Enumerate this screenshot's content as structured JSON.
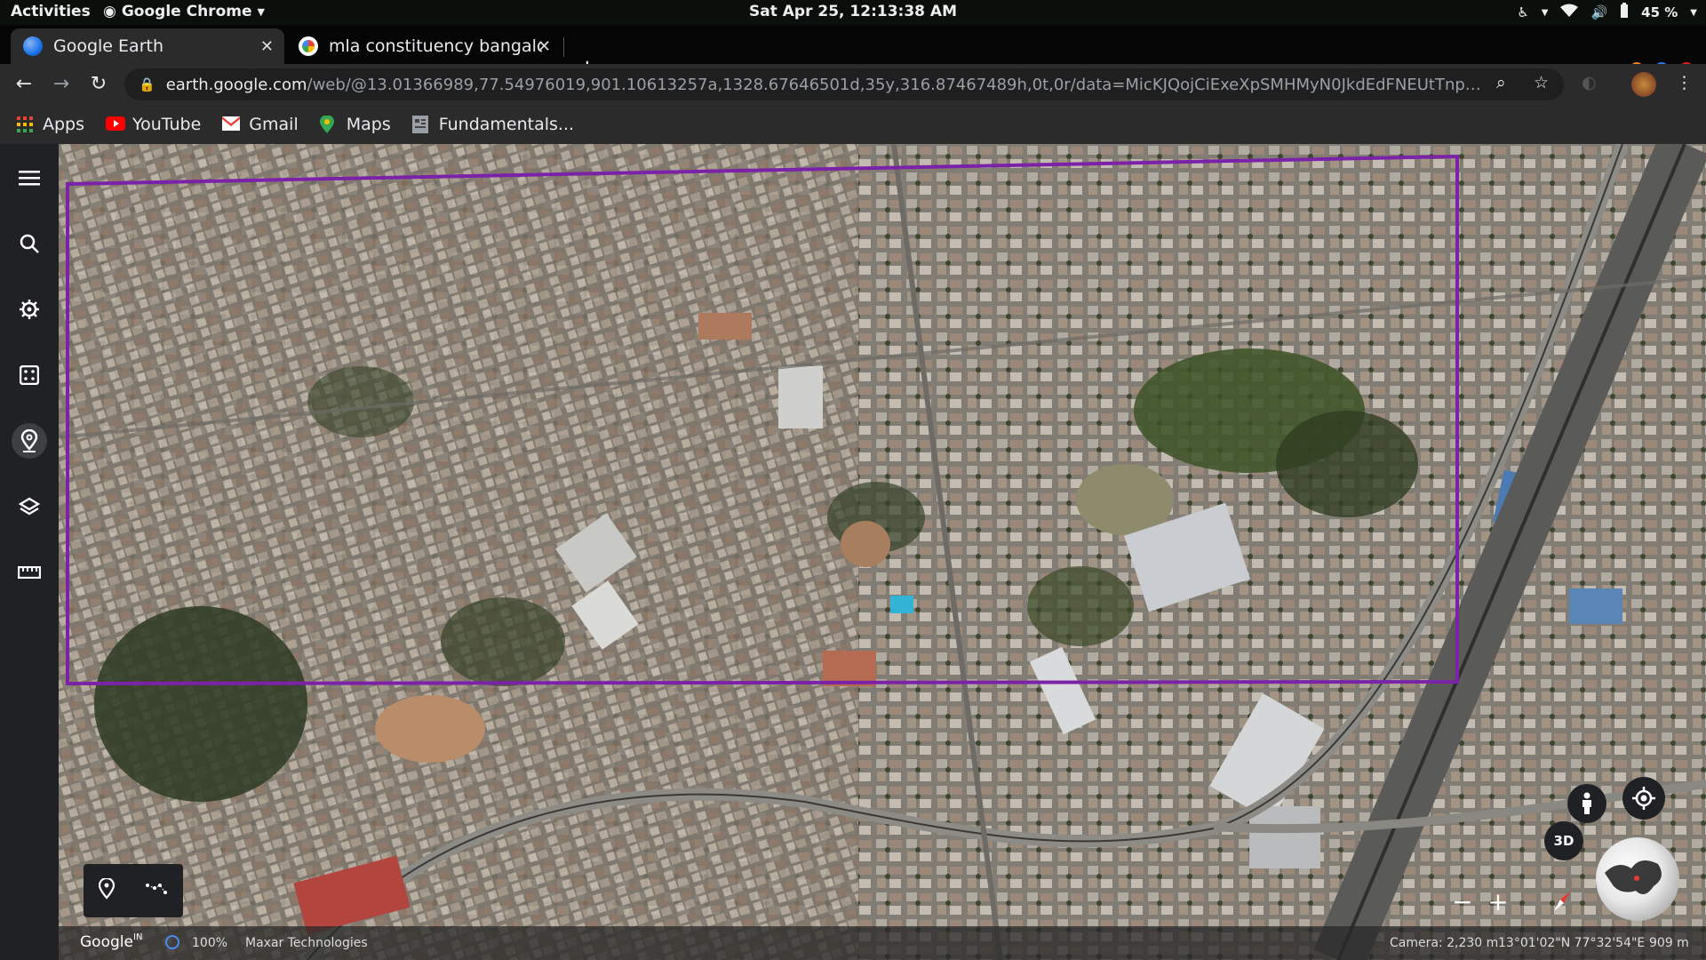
{
  "topbar": {
    "activities": "Activities",
    "app_name": "Google Chrome",
    "clock": "Sat Apr 25, 12:13:38 AM",
    "battery": "45 %"
  },
  "tabs": [
    {
      "title": "Google Earth",
      "active": true
    },
    {
      "title": "mla constituency bangalo",
      "active": false
    }
  ],
  "toolbar": {
    "url_host": "earth.google.com",
    "url_path": "/web/@13.01366989,77.54976019,901.10613257a,1328.67646501d,35y,316.87467489h,0t,0r/data=MicKJQojCiExeXpSMHMyN0JkdEdFNEUtTnp3RVZyU1lQZW..."
  },
  "bookmarks": [
    {
      "label": "Apps",
      "icon": "apps-grid-icon"
    },
    {
      "label": "YouTube",
      "icon": "youtube-icon"
    },
    {
      "label": "Gmail",
      "icon": "gmail-icon"
    },
    {
      "label": "Maps",
      "icon": "maps-pin-icon"
    },
    {
      "label": "Fundamentals...",
      "icon": "bookmark-page-icon"
    }
  ],
  "sidebar": {
    "items": [
      {
        "name": "menu",
        "icon": "hamburger-icon"
      },
      {
        "name": "search",
        "icon": "search-icon"
      },
      {
        "name": "voyager",
        "icon": "voyager-wheel-icon"
      },
      {
        "name": "feeling-lucky",
        "icon": "dice-icon"
      },
      {
        "name": "projects",
        "icon": "projects-pin-icon",
        "selected": true
      },
      {
        "name": "map-style",
        "icon": "layers-icon"
      },
      {
        "name": "measure",
        "icon": "ruler-icon"
      }
    ]
  },
  "map": {
    "highlight_color": "#7b22a8",
    "view_3d_label": "3D",
    "zoom_out": "−",
    "zoom_in": "+"
  },
  "statusbar": {
    "logo": "Google",
    "logo_region": "IN",
    "load_percent": "100%",
    "attribution": "Maxar Technologies",
    "camera": "Camera: 2,230 m",
    "coords": "13°01'02\"N 77°32'54\"E",
    "altitude": "909 m"
  }
}
